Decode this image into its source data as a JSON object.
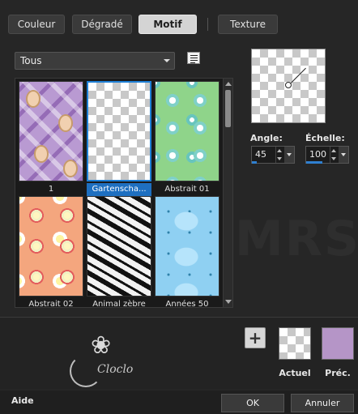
{
  "tabs": [
    {
      "label": "Couleur",
      "active": false
    },
    {
      "label": "Dégradé",
      "active": false
    },
    {
      "label": "Motif",
      "active": true
    },
    {
      "label": "Texture",
      "active": false
    }
  ],
  "category_select": {
    "value": "Tous"
  },
  "patterns": [
    {
      "label": "1",
      "selected": false,
      "style": "purple-portrait"
    },
    {
      "label": "Gartenscha...",
      "selected": true,
      "style": "transparent-checker"
    },
    {
      "label": "Abstrait 01",
      "selected": false,
      "style": "green-circles"
    },
    {
      "label": "Abstrait 02",
      "selected": false,
      "style": "orange-circles"
    },
    {
      "label": "Animal zèbre",
      "selected": false,
      "style": "zebra"
    },
    {
      "label": "Années 50",
      "selected": false,
      "style": "blue-fifties"
    }
  ],
  "angle": {
    "label": "Angle:",
    "value": "45"
  },
  "scale": {
    "label": "Échelle:",
    "value": "100"
  },
  "swatches": {
    "current_label": "Actuel",
    "previous_label": "Préc.",
    "previous_color": "#b595c7"
  },
  "logo_text": "Cloclo",
  "footer": {
    "help_label": "Aide",
    "ok_label": "OK",
    "cancel_label": "Annuler"
  },
  "colors": {
    "background": "#262626",
    "selection": "#1e6fc0"
  }
}
